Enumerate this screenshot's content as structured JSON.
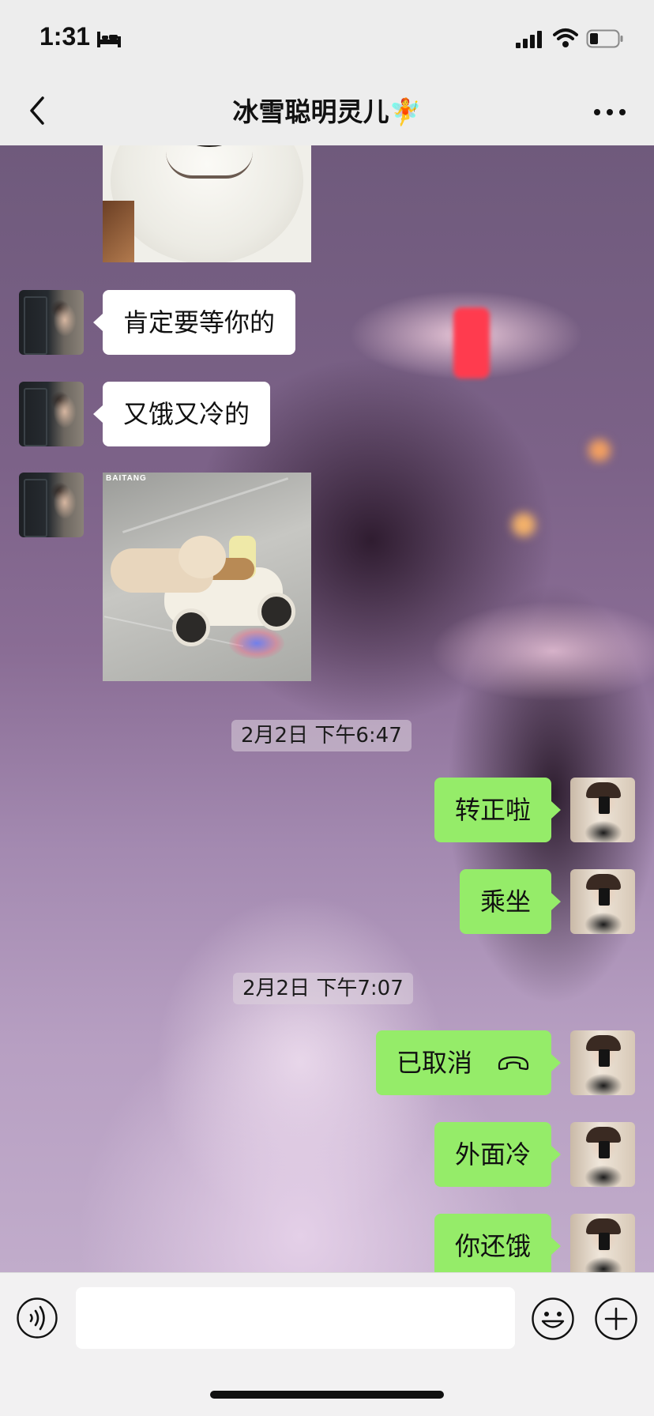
{
  "status_bar": {
    "time": "1:31",
    "icons": [
      "bed-icon",
      "signal-icon",
      "wifi-icon",
      "battery-icon"
    ]
  },
  "header": {
    "back_icon": "chevron-left-icon",
    "title": "冰雪聪明灵儿🧚",
    "more_icon": "more-dots-icon"
  },
  "messages": [
    {
      "sender": "friend",
      "type": "sticker",
      "sticker": "white-dog-face"
    },
    {
      "sender": "friend",
      "type": "text",
      "text": "肯定要等你的"
    },
    {
      "sender": "friend",
      "type": "text",
      "text": "又饿又冷的"
    },
    {
      "sender": "friend",
      "type": "sticker",
      "sticker": "cat-riding-scooter",
      "watermark": "BAITANG"
    },
    {
      "type": "timestamp",
      "text": "2月2日 下午6:47"
    },
    {
      "sender": "me",
      "type": "text",
      "text": "转正啦"
    },
    {
      "sender": "me",
      "type": "text",
      "text": "乘坐"
    },
    {
      "type": "timestamp",
      "text": "2月2日 下午7:07"
    },
    {
      "sender": "me",
      "type": "call",
      "text": "已取消",
      "icon": "phone-hangup-icon"
    },
    {
      "sender": "me",
      "type": "text",
      "text": "外面冷"
    },
    {
      "sender": "me",
      "type": "text",
      "text": "你还饿"
    }
  ],
  "input_bar": {
    "voice_icon": "voice-icon",
    "input_value": "",
    "emoji_icon": "emoji-icon",
    "plus_icon": "plus-icon"
  },
  "colors": {
    "my_bubble": "#95ec69",
    "friend_bubble": "#ffffff",
    "bar_background": "#ededed"
  }
}
